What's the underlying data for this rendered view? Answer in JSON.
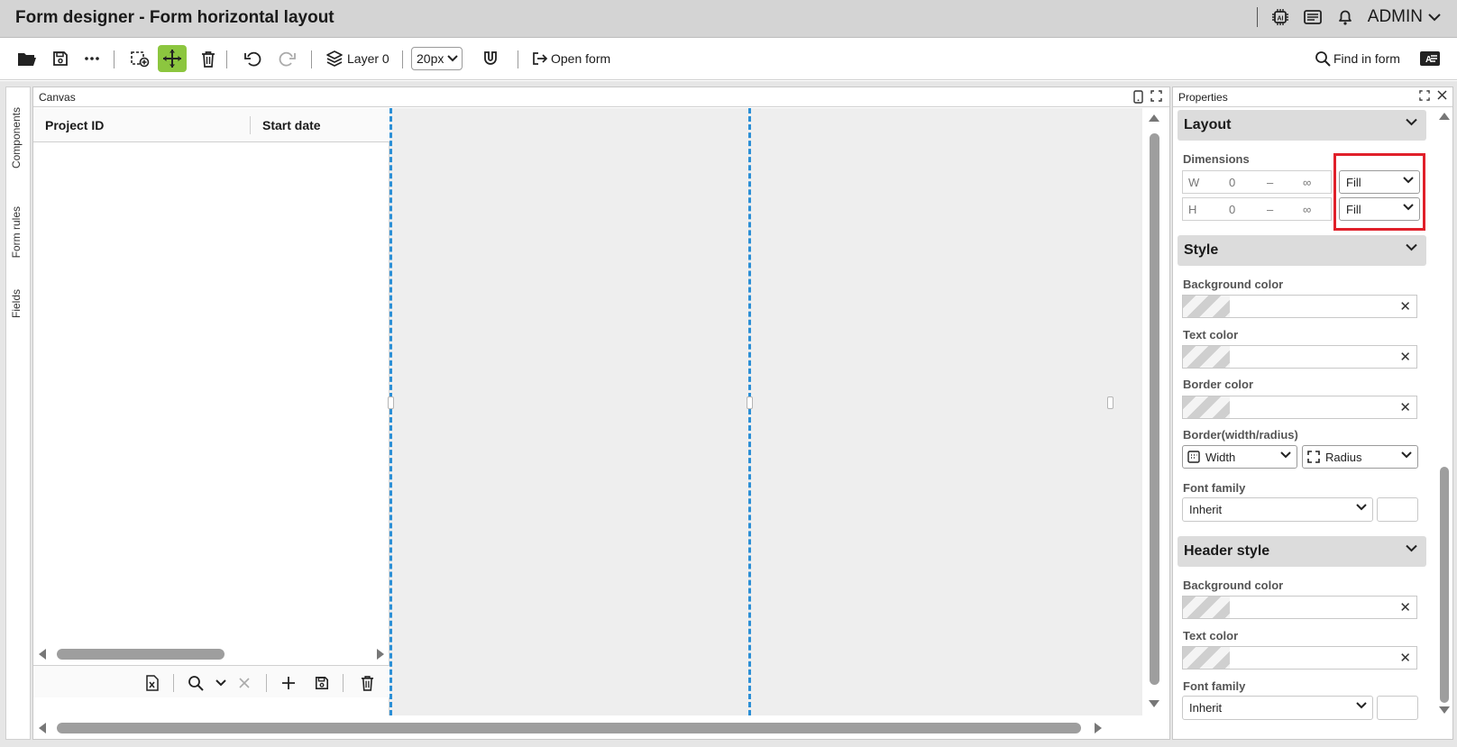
{
  "window": {
    "title": "Form designer - Form horizontal layout",
    "user": "ADMIN"
  },
  "toolbar": {
    "layer_label": "Layer 0",
    "grid_size": "20px",
    "open_form_label": "Open form",
    "find_label": "Find in form"
  },
  "side_tabs": [
    "Components",
    "Form rules",
    "Fields"
  ],
  "canvas": {
    "title": "Canvas",
    "grid": {
      "columns": [
        "Project ID",
        "Start date"
      ]
    }
  },
  "properties": {
    "title": "Properties",
    "layout": {
      "title": "Layout",
      "dimensions_label": "Dimensions",
      "width": {
        "prefix": "W",
        "min": "0",
        "dash": "–",
        "max": "∞",
        "mode": "Fill"
      },
      "height": {
        "prefix": "H",
        "min": "0",
        "dash": "–",
        "max": "∞",
        "mode": "Fill"
      }
    },
    "style": {
      "title": "Style",
      "background_color_label": "Background color",
      "text_color_label": "Text color",
      "border_color_label": "Border color",
      "border_label": "Border(width/radius)",
      "width_option": "Width",
      "radius_option": "Radius",
      "font_family_label": "Font family",
      "font_family_value": "Inherit"
    },
    "header_style": {
      "title": "Header style",
      "background_color_label": "Background color",
      "text_color_label": "Text color",
      "font_family_label": "Font family",
      "font_family_value": "Inherit"
    }
  },
  "colors": {
    "accent_active": "#8cc63f",
    "guide_line": "#2b8fd6",
    "highlight": "#e0202a"
  }
}
